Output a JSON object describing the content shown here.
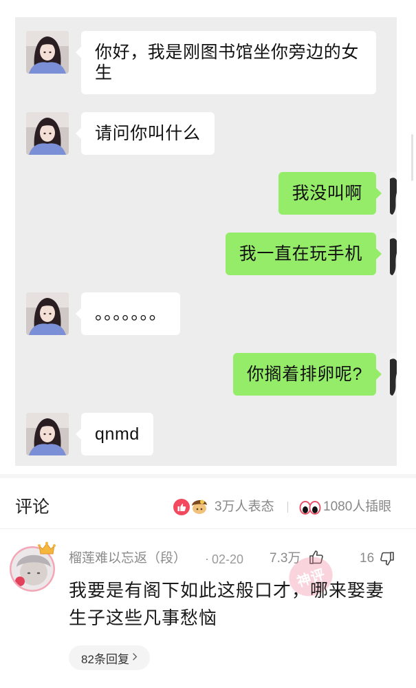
{
  "chat": {
    "messages": [
      {
        "sender": "other",
        "text": "你好，我是刚图书馆坐你旁边的女生"
      },
      {
        "sender": "other",
        "text": "请问你叫什么"
      },
      {
        "sender": "self",
        "text": "我没叫啊"
      },
      {
        "sender": "self",
        "text": "我一直在玩手机"
      },
      {
        "sender": "other",
        "text": "。。。。。。。"
      },
      {
        "sender": "self",
        "text": "你搁着排卵呢?"
      },
      {
        "sender": "other",
        "text": "qnmd"
      }
    ],
    "colors": {
      "background": "#ededed",
      "bubble_left": "#ffffff",
      "bubble_right": "#95ec69"
    }
  },
  "comments_header": {
    "title": "评论",
    "reactions_label": "3万人表态",
    "eyes_label": "1080人插眼",
    "icons": [
      "thumbs-up-reaction-icon",
      "hat-reaction-icon",
      "eyes-icon"
    ]
  },
  "comment": {
    "username": "榴莲难以忘返（段）",
    "date_separator": "·",
    "date": "02-20",
    "likes": "7.3万",
    "dislikes": "16",
    "text": "我要是有阁下如此这般口才，哪来娶妻生子这些凡事愁恼",
    "stamp": "神评",
    "reply_label": "82条回复",
    "icons": [
      "crown-icon",
      "thumbs-up-icon",
      "thumbs-down-icon",
      "chevron-right-icon"
    ]
  }
}
